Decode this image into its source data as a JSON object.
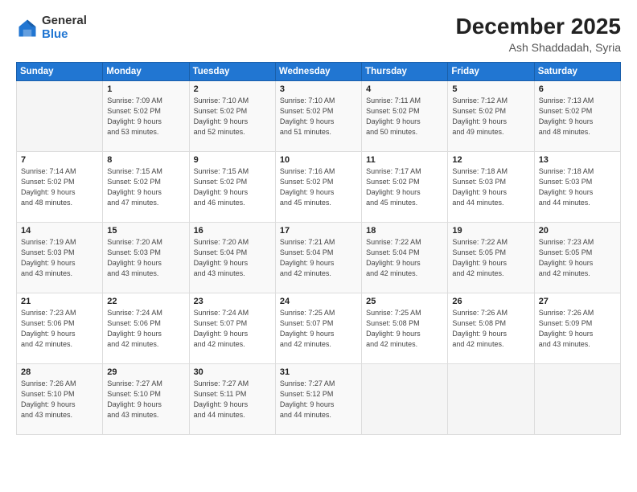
{
  "header": {
    "logo_general": "General",
    "logo_blue": "Blue",
    "main_title": "December 2025",
    "subtitle": "Ash Shaddadah, Syria"
  },
  "weekdays": [
    "Sunday",
    "Monday",
    "Tuesday",
    "Wednesday",
    "Thursday",
    "Friday",
    "Saturday"
  ],
  "weeks": [
    [
      {
        "day": "",
        "detail": ""
      },
      {
        "day": "1",
        "detail": "Sunrise: 7:09 AM\nSunset: 5:02 PM\nDaylight: 9 hours\nand 53 minutes."
      },
      {
        "day": "2",
        "detail": "Sunrise: 7:10 AM\nSunset: 5:02 PM\nDaylight: 9 hours\nand 52 minutes."
      },
      {
        "day": "3",
        "detail": "Sunrise: 7:10 AM\nSunset: 5:02 PM\nDaylight: 9 hours\nand 51 minutes."
      },
      {
        "day": "4",
        "detail": "Sunrise: 7:11 AM\nSunset: 5:02 PM\nDaylight: 9 hours\nand 50 minutes."
      },
      {
        "day": "5",
        "detail": "Sunrise: 7:12 AM\nSunset: 5:02 PM\nDaylight: 9 hours\nand 49 minutes."
      },
      {
        "day": "6",
        "detail": "Sunrise: 7:13 AM\nSunset: 5:02 PM\nDaylight: 9 hours\nand 48 minutes."
      }
    ],
    [
      {
        "day": "7",
        "detail": "Sunrise: 7:14 AM\nSunset: 5:02 PM\nDaylight: 9 hours\nand 48 minutes."
      },
      {
        "day": "8",
        "detail": "Sunrise: 7:15 AM\nSunset: 5:02 PM\nDaylight: 9 hours\nand 47 minutes."
      },
      {
        "day": "9",
        "detail": "Sunrise: 7:15 AM\nSunset: 5:02 PM\nDaylight: 9 hours\nand 46 minutes."
      },
      {
        "day": "10",
        "detail": "Sunrise: 7:16 AM\nSunset: 5:02 PM\nDaylight: 9 hours\nand 45 minutes."
      },
      {
        "day": "11",
        "detail": "Sunrise: 7:17 AM\nSunset: 5:02 PM\nDaylight: 9 hours\nand 45 minutes."
      },
      {
        "day": "12",
        "detail": "Sunrise: 7:18 AM\nSunset: 5:03 PM\nDaylight: 9 hours\nand 44 minutes."
      },
      {
        "day": "13",
        "detail": "Sunrise: 7:18 AM\nSunset: 5:03 PM\nDaylight: 9 hours\nand 44 minutes."
      }
    ],
    [
      {
        "day": "14",
        "detail": "Sunrise: 7:19 AM\nSunset: 5:03 PM\nDaylight: 9 hours\nand 43 minutes."
      },
      {
        "day": "15",
        "detail": "Sunrise: 7:20 AM\nSunset: 5:03 PM\nDaylight: 9 hours\nand 43 minutes."
      },
      {
        "day": "16",
        "detail": "Sunrise: 7:20 AM\nSunset: 5:04 PM\nDaylight: 9 hours\nand 43 minutes."
      },
      {
        "day": "17",
        "detail": "Sunrise: 7:21 AM\nSunset: 5:04 PM\nDaylight: 9 hours\nand 42 minutes."
      },
      {
        "day": "18",
        "detail": "Sunrise: 7:22 AM\nSunset: 5:04 PM\nDaylight: 9 hours\nand 42 minutes."
      },
      {
        "day": "19",
        "detail": "Sunrise: 7:22 AM\nSunset: 5:05 PM\nDaylight: 9 hours\nand 42 minutes."
      },
      {
        "day": "20",
        "detail": "Sunrise: 7:23 AM\nSunset: 5:05 PM\nDaylight: 9 hours\nand 42 minutes."
      }
    ],
    [
      {
        "day": "21",
        "detail": "Sunrise: 7:23 AM\nSunset: 5:06 PM\nDaylight: 9 hours\nand 42 minutes."
      },
      {
        "day": "22",
        "detail": "Sunrise: 7:24 AM\nSunset: 5:06 PM\nDaylight: 9 hours\nand 42 minutes."
      },
      {
        "day": "23",
        "detail": "Sunrise: 7:24 AM\nSunset: 5:07 PM\nDaylight: 9 hours\nand 42 minutes."
      },
      {
        "day": "24",
        "detail": "Sunrise: 7:25 AM\nSunset: 5:07 PM\nDaylight: 9 hours\nand 42 minutes."
      },
      {
        "day": "25",
        "detail": "Sunrise: 7:25 AM\nSunset: 5:08 PM\nDaylight: 9 hours\nand 42 minutes."
      },
      {
        "day": "26",
        "detail": "Sunrise: 7:26 AM\nSunset: 5:08 PM\nDaylight: 9 hours\nand 42 minutes."
      },
      {
        "day": "27",
        "detail": "Sunrise: 7:26 AM\nSunset: 5:09 PM\nDaylight: 9 hours\nand 43 minutes."
      }
    ],
    [
      {
        "day": "28",
        "detail": "Sunrise: 7:26 AM\nSunset: 5:10 PM\nDaylight: 9 hours\nand 43 minutes."
      },
      {
        "day": "29",
        "detail": "Sunrise: 7:27 AM\nSunset: 5:10 PM\nDaylight: 9 hours\nand 43 minutes."
      },
      {
        "day": "30",
        "detail": "Sunrise: 7:27 AM\nSunset: 5:11 PM\nDaylight: 9 hours\nand 44 minutes."
      },
      {
        "day": "31",
        "detail": "Sunrise: 7:27 AM\nSunset: 5:12 PM\nDaylight: 9 hours\nand 44 minutes."
      },
      {
        "day": "",
        "detail": ""
      },
      {
        "day": "",
        "detail": ""
      },
      {
        "day": "",
        "detail": ""
      }
    ]
  ]
}
